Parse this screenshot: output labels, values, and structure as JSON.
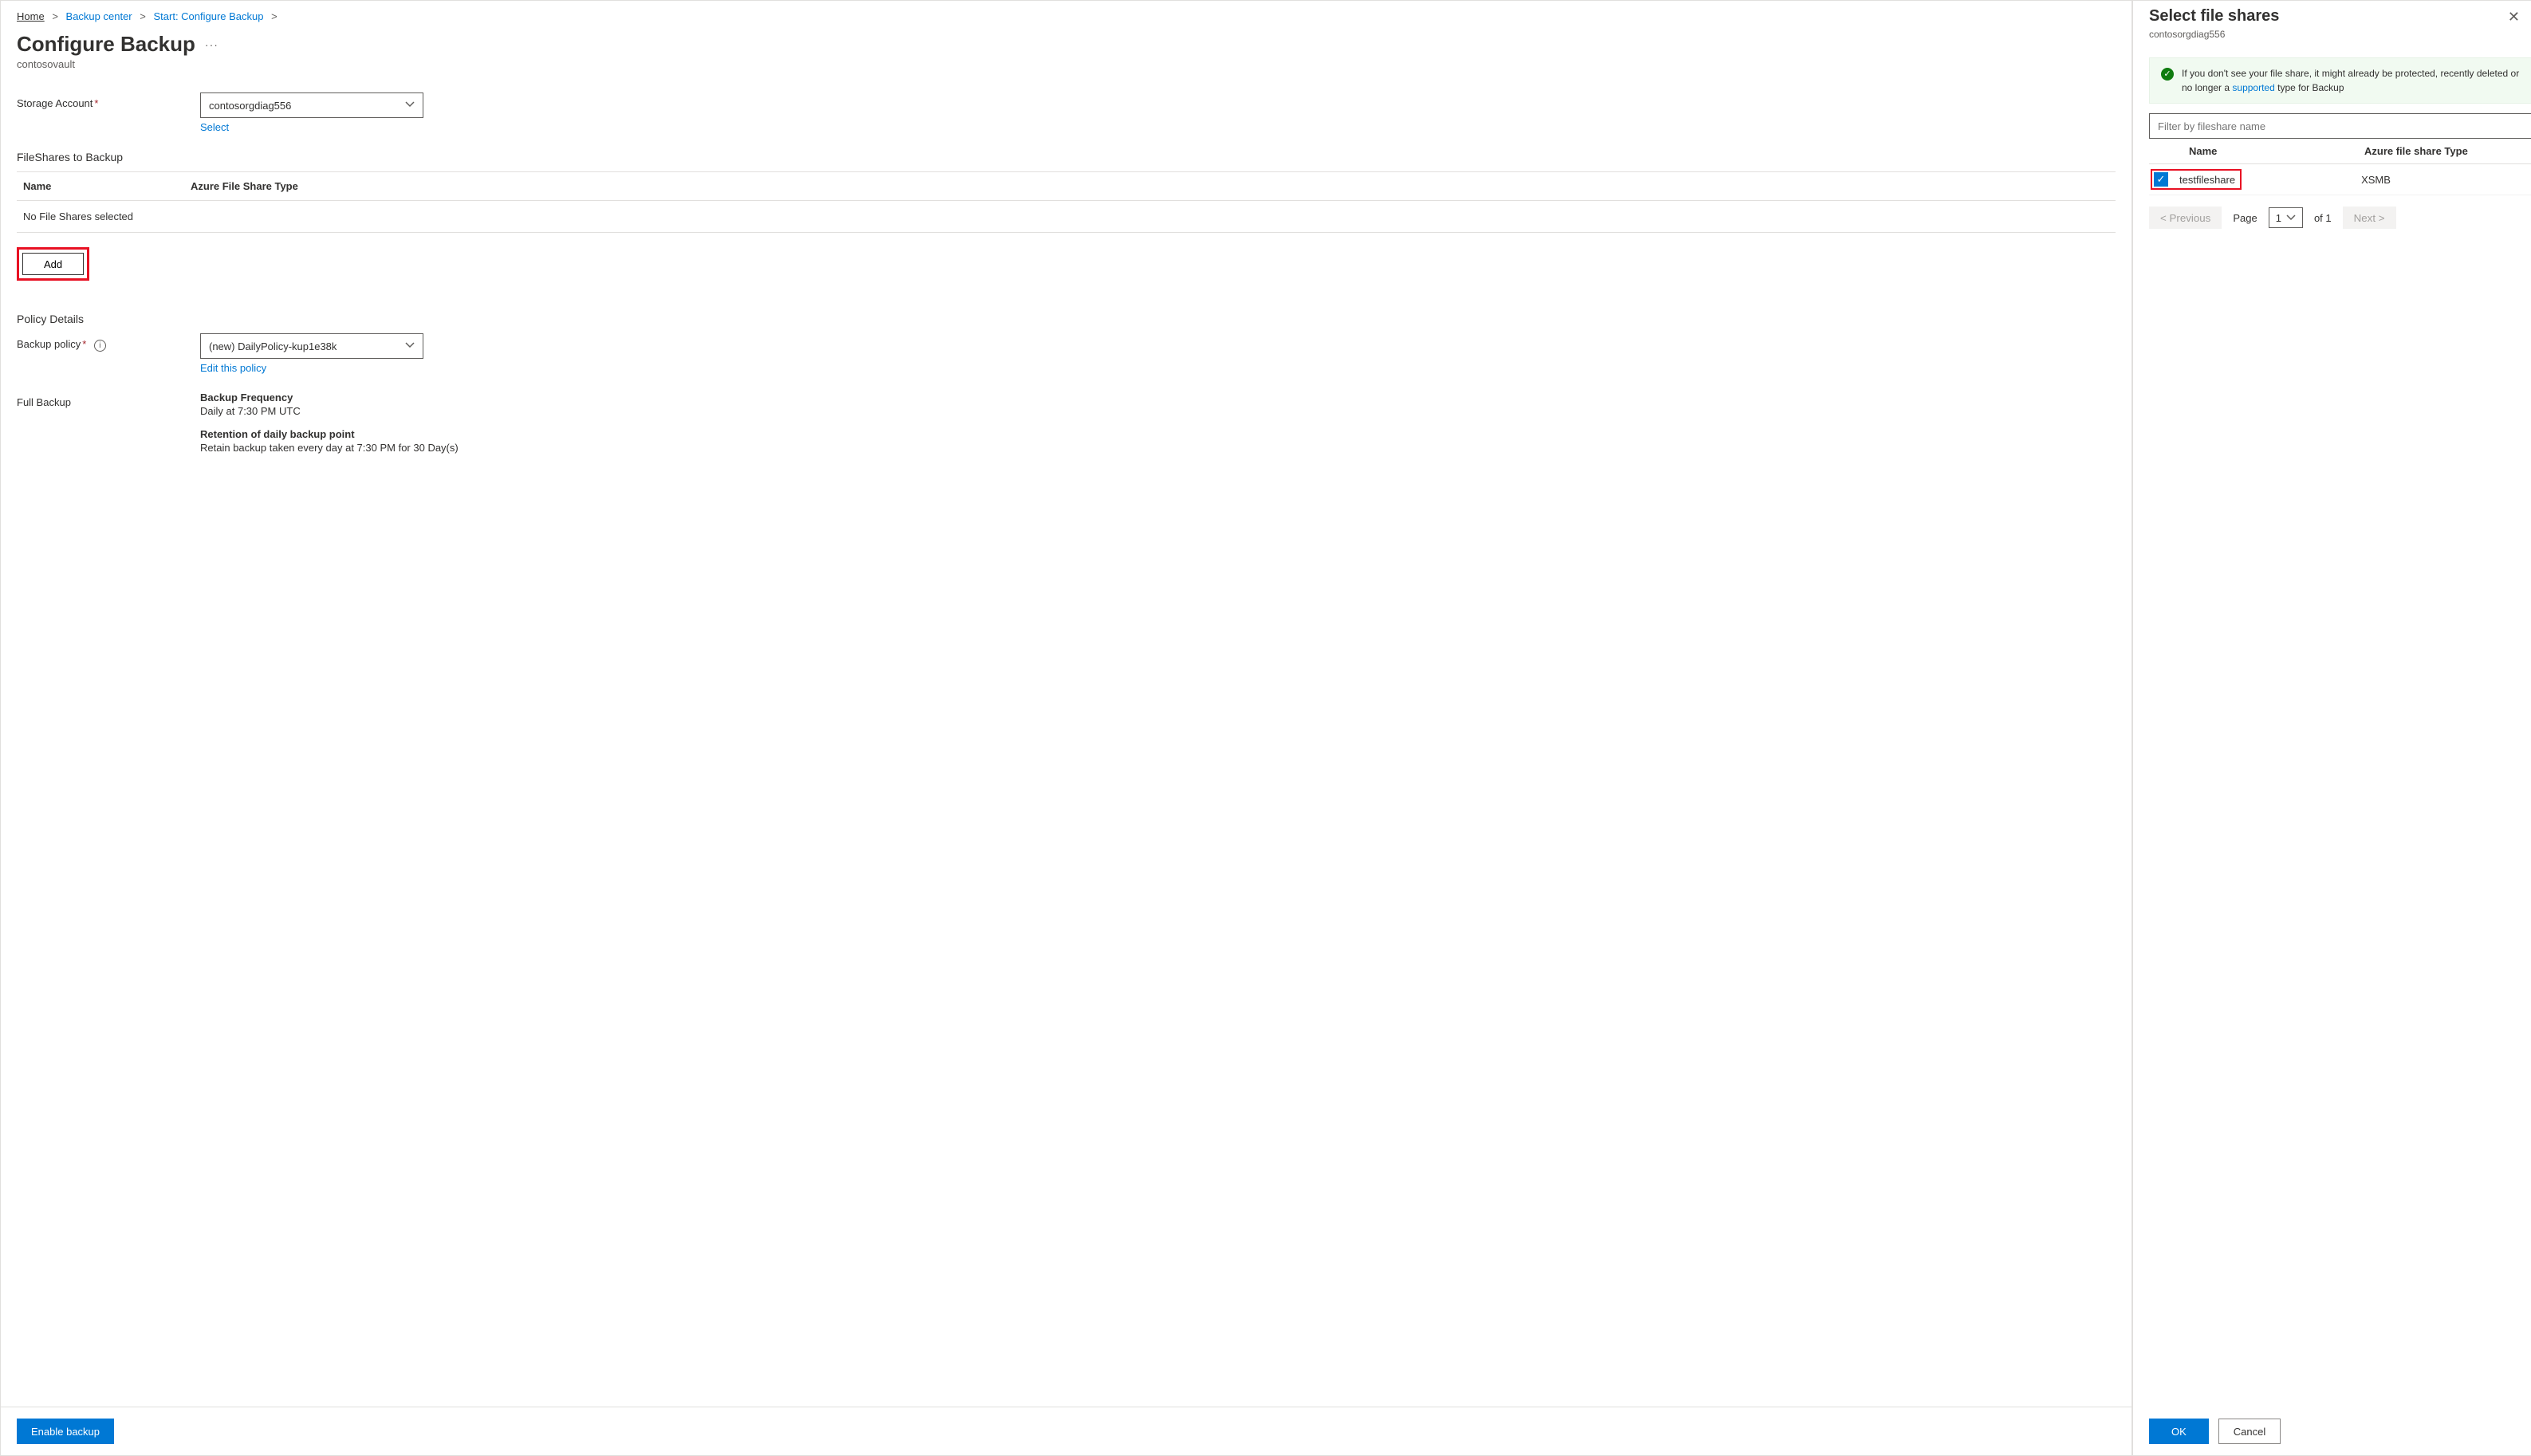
{
  "breadcrumb": {
    "home": "Home",
    "center": "Backup center",
    "start": "Start: Configure Backup"
  },
  "page": {
    "title": "Configure Backup",
    "subtitle": "contosovault"
  },
  "storage": {
    "label": "Storage Account",
    "value": "contosorgdiag556",
    "select_link": "Select"
  },
  "fileshares": {
    "heading": "FileShares to Backup",
    "col_name": "Name",
    "col_type": "Azure File Share Type",
    "empty": "No File Shares selected",
    "add_label": "Add"
  },
  "policy": {
    "heading": "Policy Details",
    "label": "Backup policy",
    "value": "(new) DailyPolicy-kup1e38k",
    "edit_link": "Edit this policy",
    "full_label": "Full Backup",
    "freq_label": "Backup Frequency",
    "freq_value": "Daily at 7:30 PM UTC",
    "ret_label": "Retention of daily backup point",
    "ret_value": "Retain backup taken every day at 7:30 PM for 30 Day(s)"
  },
  "footer": {
    "enable": "Enable backup"
  },
  "panel": {
    "title": "Select file shares",
    "subtitle": "contosorgdiag556",
    "info_pre": "If you don't see your file share, it might already be protected, recently deleted or no longer a",
    "info_link": "supported",
    "info_post": "type for Backup",
    "filter_placeholder": "Filter by fileshare name",
    "col_name": "Name",
    "col_type": "Azure file share Type",
    "row_name": "testfileshare",
    "row_type": "XSMB",
    "prev": "< Previous",
    "page_word": "Page",
    "page_num": "1",
    "of": "of 1",
    "next": "Next >",
    "ok": "OK",
    "cancel": "Cancel"
  }
}
